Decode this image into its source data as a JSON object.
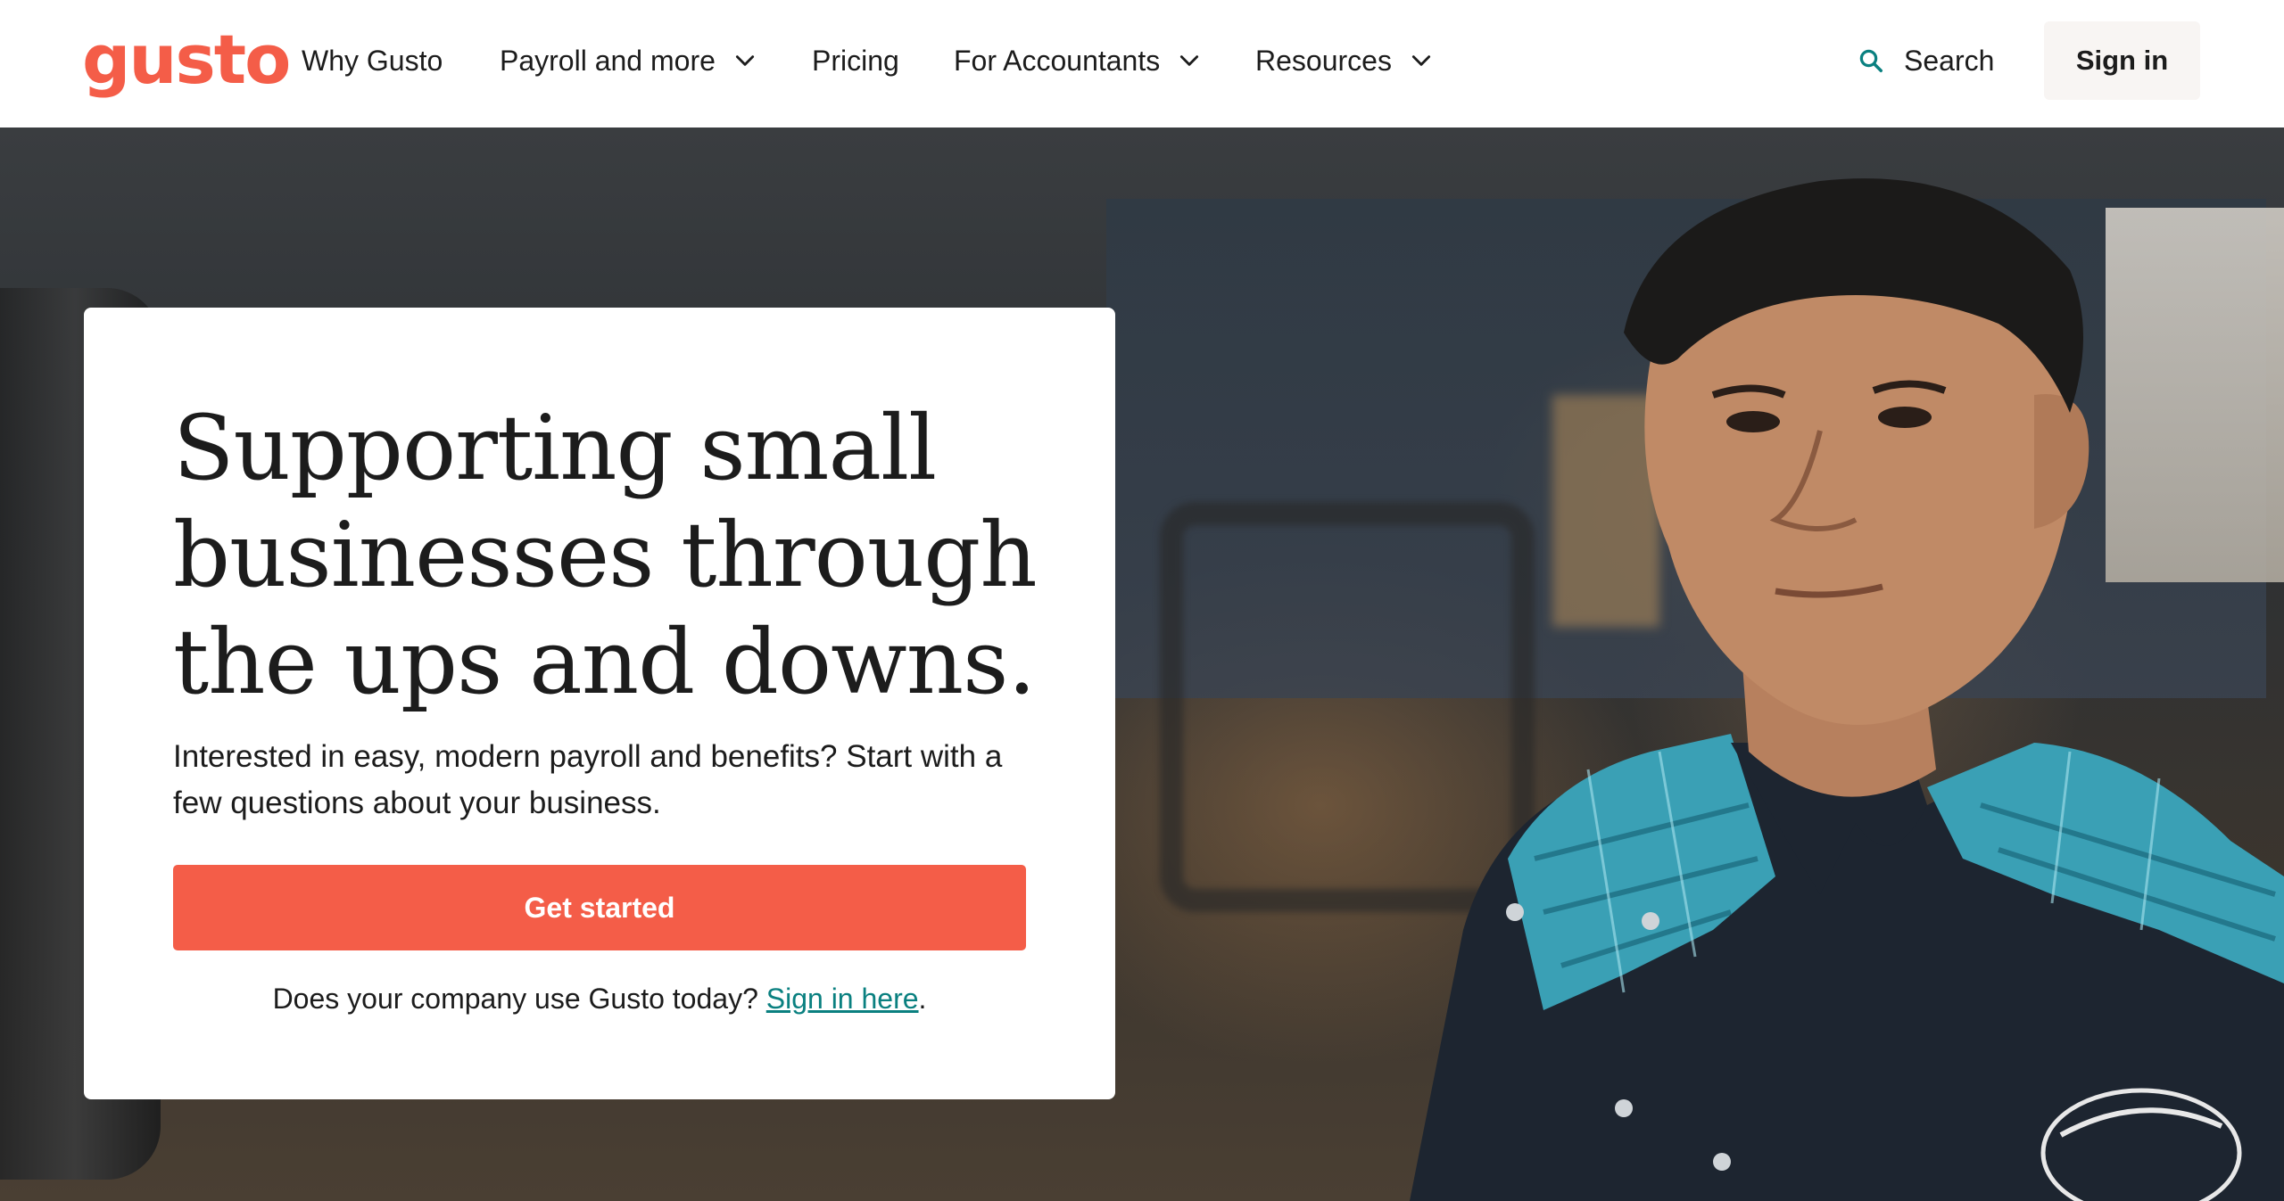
{
  "header": {
    "logo_text": "gusto",
    "nav": [
      {
        "label": "Why Gusto",
        "has_dropdown": false
      },
      {
        "label": "Payroll and more",
        "has_dropdown": true
      },
      {
        "label": "Pricing",
        "has_dropdown": false
      },
      {
        "label": "For Accountants",
        "has_dropdown": true
      },
      {
        "label": "Resources",
        "has_dropdown": true
      }
    ],
    "search_label": "Search",
    "search_icon": "search-icon",
    "signin_label": "Sign in"
  },
  "hero": {
    "headline_lines": [
      "Supporting small",
      "businesses through",
      "the ups and downs."
    ],
    "subtext": "Interested in easy, modern payroll and benefits? Start with a few questions about your business.",
    "cta_label": "Get started",
    "existing_prompt": "Does your company use Gusto today?",
    "existing_link": "Sign in here",
    "existing_suffix": "."
  },
  "colors": {
    "brand": "#f45d48",
    "link": "#0a8080",
    "text": "#1c1c1c",
    "signin_bg": "#f8f5f3"
  }
}
